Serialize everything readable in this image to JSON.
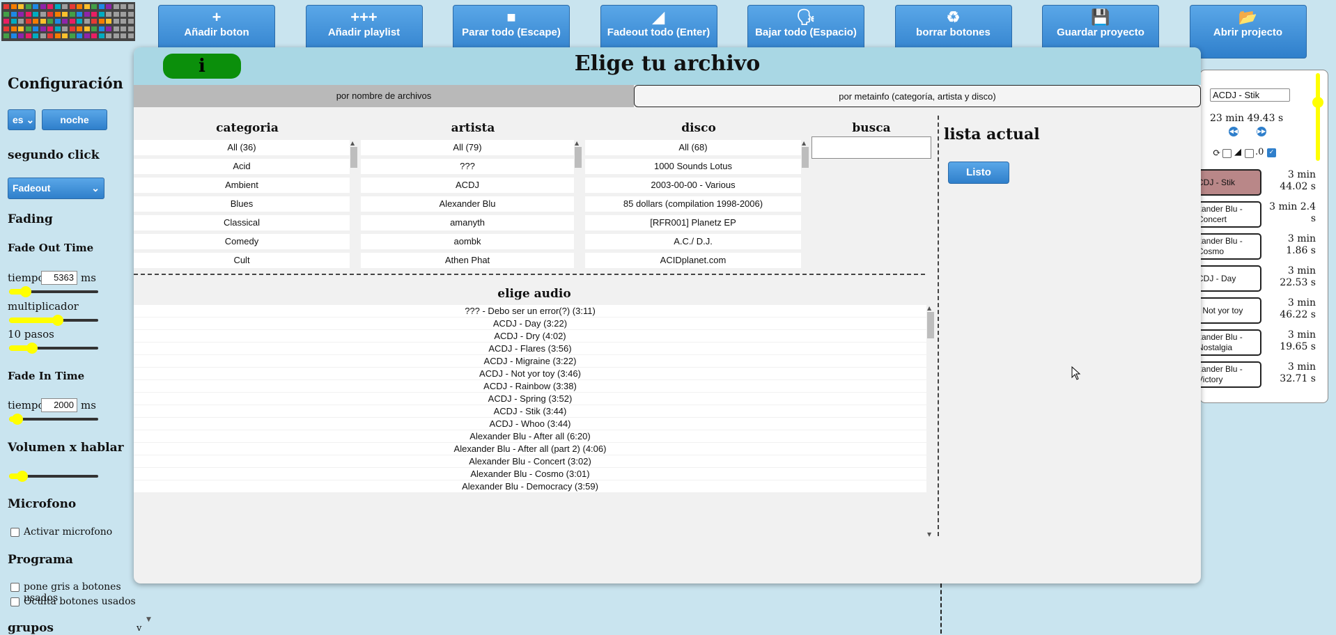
{
  "toolbar": {
    "buttons": [
      {
        "icon": "plus-icon",
        "glyph": "+",
        "label": "Añadir boton"
      },
      {
        "icon": "playlist-add-icon",
        "glyph": "+++",
        "label": "Añadir playlist"
      },
      {
        "icon": "stop-icon",
        "glyph": "■",
        "label": "Parar todo (Escape)"
      },
      {
        "icon": "fadeout-icon",
        "glyph": "◢",
        "label": "Fadeout todo (Enter)"
      },
      {
        "icon": "speak-icon",
        "glyph": "🗣",
        "label": "Bajar todo (Espacio)"
      },
      {
        "icon": "recycle-icon",
        "glyph": "♻",
        "label": "borrar botones"
      },
      {
        "icon": "save-icon",
        "glyph": "💾",
        "label": "Guardar proyecto"
      },
      {
        "icon": "folder-open-icon",
        "glyph": "📂",
        "label": "Abrir projecto"
      }
    ]
  },
  "left": {
    "title": "Configuración",
    "lang_value": "es",
    "night_button": "noche",
    "second_click_heading": "segundo click",
    "second_click_value": "Fadeout",
    "fading_heading": "Fading",
    "fade_out_heading": "Fade Out Time",
    "fade_out_time_label": "tiempo",
    "fade_out_time_value": "5363",
    "ms_unit": "ms",
    "fade_out_time_level": 0.14,
    "multiplier_label": "multiplicador",
    "multiplier_level": 0.55,
    "steps_label": "10 pasos",
    "steps_level": 0.22,
    "fade_in_heading": "Fade In Time",
    "fade_in_time_label": "tiempo",
    "fade_in_time_value": "2000",
    "fade_in_time_level": 0.04,
    "volume_heading": "Volumen x hablar",
    "volume_level": 0.1,
    "mic_heading": "Microfono",
    "mic_checkbox_label": "Activar microfono",
    "program_heading": "Programa",
    "gray_used_label": "pone gris a botones usados",
    "hide_used_label": "Oculta botones usados",
    "groups_heading": "grupos",
    "groups_toggle": "v"
  },
  "right": {
    "current_track": "ACDJ - Stik",
    "total_time": "23 min 49.43 s",
    "loop_value": ".0",
    "items": [
      {
        "label": "CDJ - Stik",
        "time": "3 min 44.02 s",
        "active": true
      },
      {
        "label": "xander Blu - Concert",
        "time": "3 min 2.4 s",
        "active": false
      },
      {
        "label": "xander Blu - Cosmo",
        "time": "3 min 1.86 s",
        "active": false
      },
      {
        "label": "CDJ - Day",
        "time": "3 min 22.53 s",
        "active": false
      },
      {
        "label": "- Not yor toy",
        "time": "3 min 46.22 s",
        "active": false
      },
      {
        "label": "xander Blu - Nostalgia",
        "time": "3 min 19.65 s",
        "active": false
      },
      {
        "label": "xander Blu - Victory",
        "time": "3 min 32.71 s",
        "active": false
      }
    ]
  },
  "modal": {
    "info_label": "i",
    "title": "Elige tu archivo",
    "tab_by_name": "por nombre de archivos",
    "tab_by_meta": "por metainfo (categoría, artista y disco)",
    "columns": {
      "categoria": {
        "heading": "categoria",
        "items": [
          "All (36)",
          "Acid",
          "Ambient",
          "Blues",
          "Classical",
          "Comedy",
          "Cult"
        ]
      },
      "artista": {
        "heading": "artista",
        "items": [
          "All (79)",
          "???",
          "ACDJ",
          "Alexander Blu",
          "amanyth",
          "aombk",
          "Athen Phat"
        ]
      },
      "disco": {
        "heading": "disco",
        "items": [
          "All (68)",
          "1000 Sounds Lotus",
          "2003-00-00 - Various",
          "85 dollars (compilation 1998-2006)",
          "[RFR001] Planetz EP",
          "A.C./ D.J.",
          "ACIDplanet.com"
        ]
      }
    },
    "search_heading": "busca",
    "search_value": "",
    "current_list_heading": "lista actual",
    "done_button": "Listo",
    "audio_heading": "elige audio",
    "audio_items": [
      "??? - Debo ser un error(?) (3:11)",
      "ACDJ - Day (3:22)",
      "ACDJ - Dry (4:02)",
      "ACDJ - Flares (3:56)",
      "ACDJ - Migraine (3:22)",
      "ACDJ - Not yor toy (3:46)",
      "ACDJ - Rainbow (3:38)",
      "ACDJ - Spring (3:52)",
      "ACDJ - Stik (3:44)",
      "ACDJ - Whoo (3:44)",
      "Alexander Blu - After all (6:20)",
      "Alexander Blu - After all (part 2) (4:06)",
      "Alexander Blu - Concert (3:02)",
      "Alexander Blu - Cosmo (3:01)",
      "Alexander Blu - Democracy (3:59)"
    ]
  },
  "colors": {
    "background": "#c9e4ef",
    "button_blue": "#2f7fcb",
    "modal_header": "#a9d7e4",
    "info_green": "#0b8f0b",
    "active_track": "#b98788",
    "slider_yellow": "#ffff00"
  }
}
